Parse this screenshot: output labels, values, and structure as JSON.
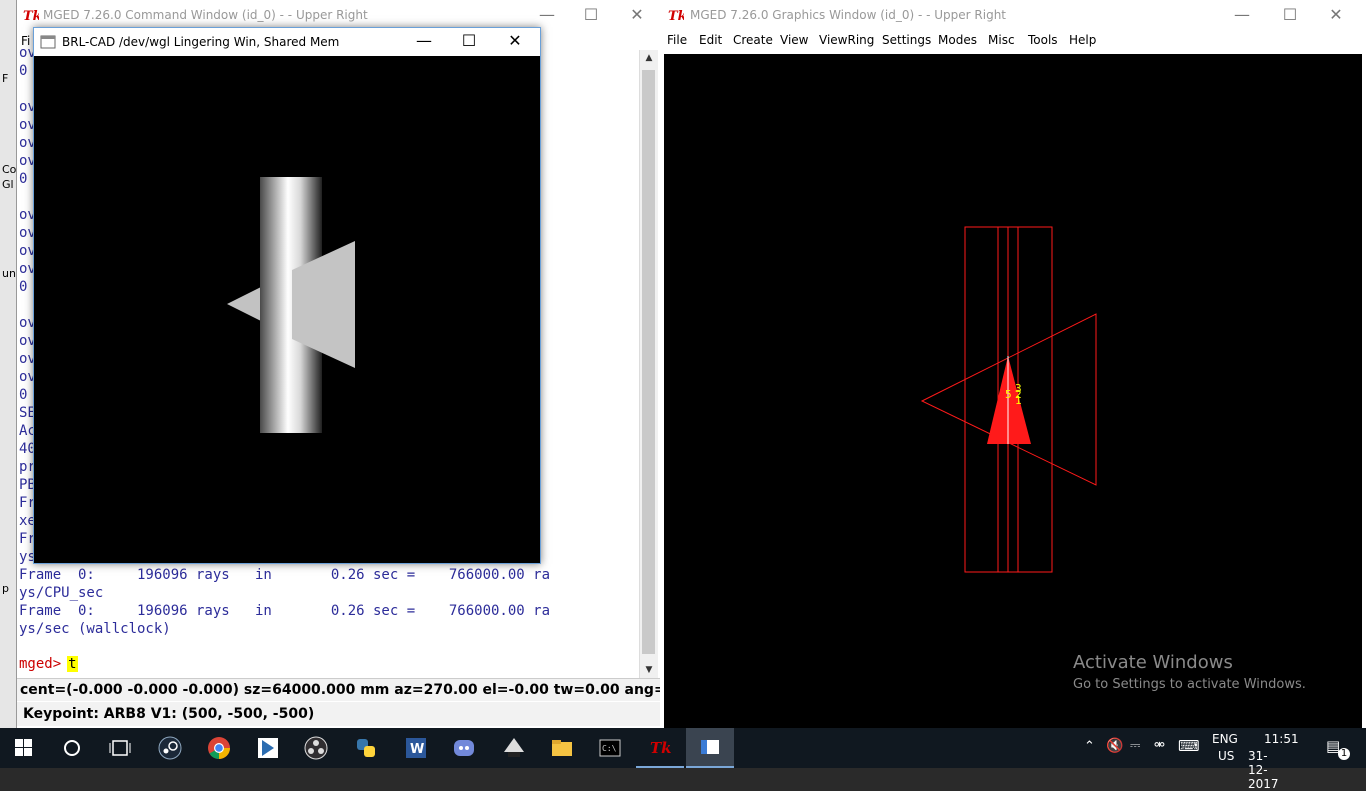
{
  "desktop_fragments": [
    "F",
    "Co",
    "Gl",
    "un",
    "p"
  ],
  "command_window": {
    "title": "MGED 7.26.0 Command Window (id_0) -  - Upper Right",
    "menu_first": "Fi",
    "lines": [
      "ov                                  6 y284 lvl",
      "0",
      "",
      "ov",
      "ov",
      "ov",
      "ov                                  6 y285 lvl",
      "0",
      "",
      "ov",
      "ov",
      "ov",
      "ov                                  6 y286 lvl",
      "0",
      "",
      "ov",
      "ov",
      "ov",
      "ov                                  6 y287 lvl",
      "0",
      "SE                                 100%)",
      "Ac                                 etained)",
      "40                                 ss",
      "pr                                  0 solid R",
      "PB",
      "Fr                                 6000.00 pi",
      "xe",
      "Fr                                 4000.00 ra",
      "ys",
      "Frame  0:     196096 rays   in       0.26 sec =    766000.00 ra",
      "ys/CPU_sec",
      "Frame  0:     196096 rays   in       0.26 sec =    766000.00 ra",
      "ys/sec (wallclock)"
    ],
    "prompt": "mged>",
    "input": "t",
    "status_line": "cent=(-0.000 -0.000 -0.000) sz=64000.000  mm  az=270.00  el=-0.00  tw=0.00  ang=(0.00",
    "keypoint": "Keypoint: ARB8 V1: (500, -500, -500)"
  },
  "graphics_window": {
    "title": "MGED 7.26.0 Graphics Window (id_0) -  - Upper Right",
    "menu": [
      "File",
      "Edit",
      "Create",
      "View",
      "ViewRing",
      "Settings",
      "Modes",
      "Misc",
      "Tools",
      "Help"
    ],
    "axes_labels": [
      "5",
      "2",
      "3",
      "1"
    ],
    "wire_color": "#ff1a1a",
    "label_color": "#ffff00"
  },
  "raytrace_window": {
    "title": "BRL-CAD /dev/wgl Lingering Win, Shared Mem"
  },
  "watermark": {
    "line1": "Activate Windows",
    "line2": "Go to Settings to activate Windows."
  },
  "taskbar": {
    "apps": [
      "start-icon",
      "cortana-icon",
      "task-view-icon",
      "steam-icon",
      "chrome-icon",
      "vscode-icon",
      "obs-icon",
      "python-icon",
      "word-icon",
      "discord-icon",
      "inkscape-icon",
      "explorer-icon",
      "cmd-icon",
      "mged-tk-icon",
      "brlcad-window-icon"
    ],
    "lang_top": "ENG",
    "lang_bottom": "US",
    "time": "11:51",
    "date": "31-12-2017",
    "notification_count": "1"
  }
}
